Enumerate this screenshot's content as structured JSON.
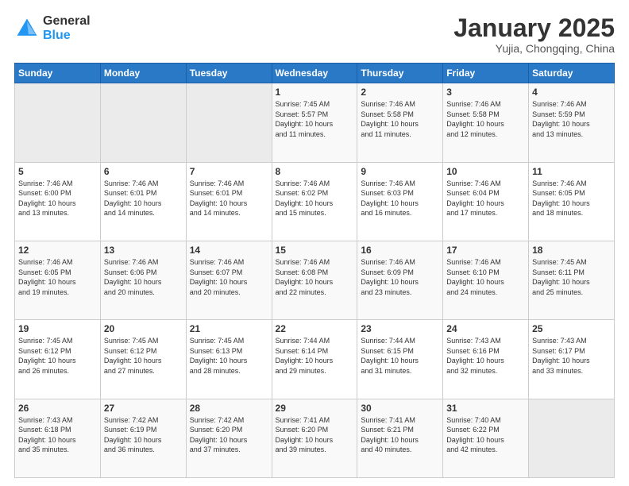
{
  "header": {
    "logo_general": "General",
    "logo_blue": "Blue",
    "title": "January 2025",
    "subtitle": "Yujia, Chongqing, China"
  },
  "weekdays": [
    "Sunday",
    "Monday",
    "Tuesday",
    "Wednesday",
    "Thursday",
    "Friday",
    "Saturday"
  ],
  "weeks": [
    [
      {
        "day": "",
        "info": ""
      },
      {
        "day": "",
        "info": ""
      },
      {
        "day": "",
        "info": ""
      },
      {
        "day": "1",
        "info": "Sunrise: 7:45 AM\nSunset: 5:57 PM\nDaylight: 10 hours\nand 11 minutes."
      },
      {
        "day": "2",
        "info": "Sunrise: 7:46 AM\nSunset: 5:58 PM\nDaylight: 10 hours\nand 11 minutes."
      },
      {
        "day": "3",
        "info": "Sunrise: 7:46 AM\nSunset: 5:58 PM\nDaylight: 10 hours\nand 12 minutes."
      },
      {
        "day": "4",
        "info": "Sunrise: 7:46 AM\nSunset: 5:59 PM\nDaylight: 10 hours\nand 13 minutes."
      }
    ],
    [
      {
        "day": "5",
        "info": "Sunrise: 7:46 AM\nSunset: 6:00 PM\nDaylight: 10 hours\nand 13 minutes."
      },
      {
        "day": "6",
        "info": "Sunrise: 7:46 AM\nSunset: 6:01 PM\nDaylight: 10 hours\nand 14 minutes."
      },
      {
        "day": "7",
        "info": "Sunrise: 7:46 AM\nSunset: 6:01 PM\nDaylight: 10 hours\nand 14 minutes."
      },
      {
        "day": "8",
        "info": "Sunrise: 7:46 AM\nSunset: 6:02 PM\nDaylight: 10 hours\nand 15 minutes."
      },
      {
        "day": "9",
        "info": "Sunrise: 7:46 AM\nSunset: 6:03 PM\nDaylight: 10 hours\nand 16 minutes."
      },
      {
        "day": "10",
        "info": "Sunrise: 7:46 AM\nSunset: 6:04 PM\nDaylight: 10 hours\nand 17 minutes."
      },
      {
        "day": "11",
        "info": "Sunrise: 7:46 AM\nSunset: 6:05 PM\nDaylight: 10 hours\nand 18 minutes."
      }
    ],
    [
      {
        "day": "12",
        "info": "Sunrise: 7:46 AM\nSunset: 6:05 PM\nDaylight: 10 hours\nand 19 minutes."
      },
      {
        "day": "13",
        "info": "Sunrise: 7:46 AM\nSunset: 6:06 PM\nDaylight: 10 hours\nand 20 minutes."
      },
      {
        "day": "14",
        "info": "Sunrise: 7:46 AM\nSunset: 6:07 PM\nDaylight: 10 hours\nand 20 minutes."
      },
      {
        "day": "15",
        "info": "Sunrise: 7:46 AM\nSunset: 6:08 PM\nDaylight: 10 hours\nand 22 minutes."
      },
      {
        "day": "16",
        "info": "Sunrise: 7:46 AM\nSunset: 6:09 PM\nDaylight: 10 hours\nand 23 minutes."
      },
      {
        "day": "17",
        "info": "Sunrise: 7:46 AM\nSunset: 6:10 PM\nDaylight: 10 hours\nand 24 minutes."
      },
      {
        "day": "18",
        "info": "Sunrise: 7:45 AM\nSunset: 6:11 PM\nDaylight: 10 hours\nand 25 minutes."
      }
    ],
    [
      {
        "day": "19",
        "info": "Sunrise: 7:45 AM\nSunset: 6:12 PM\nDaylight: 10 hours\nand 26 minutes."
      },
      {
        "day": "20",
        "info": "Sunrise: 7:45 AM\nSunset: 6:12 PM\nDaylight: 10 hours\nand 27 minutes."
      },
      {
        "day": "21",
        "info": "Sunrise: 7:45 AM\nSunset: 6:13 PM\nDaylight: 10 hours\nand 28 minutes."
      },
      {
        "day": "22",
        "info": "Sunrise: 7:44 AM\nSunset: 6:14 PM\nDaylight: 10 hours\nand 29 minutes."
      },
      {
        "day": "23",
        "info": "Sunrise: 7:44 AM\nSunset: 6:15 PM\nDaylight: 10 hours\nand 31 minutes."
      },
      {
        "day": "24",
        "info": "Sunrise: 7:43 AM\nSunset: 6:16 PM\nDaylight: 10 hours\nand 32 minutes."
      },
      {
        "day": "25",
        "info": "Sunrise: 7:43 AM\nSunset: 6:17 PM\nDaylight: 10 hours\nand 33 minutes."
      }
    ],
    [
      {
        "day": "26",
        "info": "Sunrise: 7:43 AM\nSunset: 6:18 PM\nDaylight: 10 hours\nand 35 minutes."
      },
      {
        "day": "27",
        "info": "Sunrise: 7:42 AM\nSunset: 6:19 PM\nDaylight: 10 hours\nand 36 minutes."
      },
      {
        "day": "28",
        "info": "Sunrise: 7:42 AM\nSunset: 6:20 PM\nDaylight: 10 hours\nand 37 minutes."
      },
      {
        "day": "29",
        "info": "Sunrise: 7:41 AM\nSunset: 6:20 PM\nDaylight: 10 hours\nand 39 minutes."
      },
      {
        "day": "30",
        "info": "Sunrise: 7:41 AM\nSunset: 6:21 PM\nDaylight: 10 hours\nand 40 minutes."
      },
      {
        "day": "31",
        "info": "Sunrise: 7:40 AM\nSunset: 6:22 PM\nDaylight: 10 hours\nand 42 minutes."
      },
      {
        "day": "",
        "info": ""
      }
    ]
  ]
}
